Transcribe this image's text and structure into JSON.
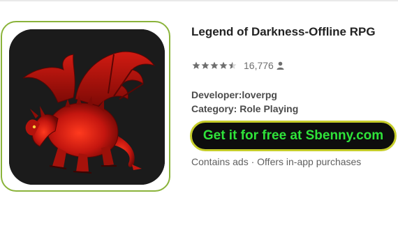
{
  "app": {
    "title": "Legend of Darkness-Offline RPG",
    "icon": "red-dragon-icon",
    "rating": {
      "stars": 4.5,
      "max_stars": 5,
      "count": "16,776"
    },
    "developer_label": "Developer:loverpg",
    "category_label": "Category: Role Playing",
    "cta_label": "Get it for free at Sbenny.com",
    "notes": "Contains ads · Offers in-app purchases"
  },
  "colors": {
    "frame_border": "#8ab33a",
    "tile_background": "#1b1b1b",
    "cta_background": "#0d0d0d",
    "cta_text": "#2fe33a",
    "cta_border": "#c5cc2a",
    "dragon": "#c4160f"
  }
}
